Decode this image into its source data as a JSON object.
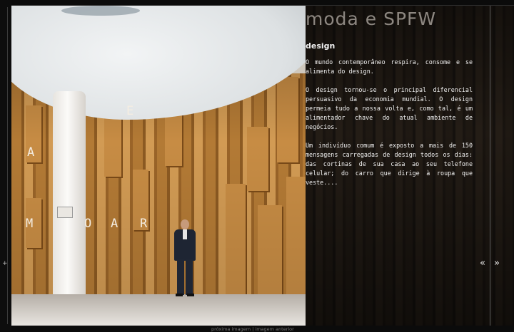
{
  "section": {
    "title": "moda e SPFW",
    "subtitle": "design",
    "paragraphs": [
      "O mundo contemporâneo respira, consome e se alimenta do design.",
      "O design tornou-se o principal diferencial persuasivo da economia mundial. O design permeia tudo a nossa volta e, como tal, é um alimentador chave do atual ambiente de negócios.",
      "Um indivíduo comum é exposto a mais de 150 mensagens carregadas de design todos os dias: das cortinas de sua casa ao seu telefone celular; do carro que dirige à roupa que veste...."
    ]
  },
  "navigation": {
    "prev_icon": "«",
    "next_icon": "»",
    "next_image_label": "próxima imagem",
    "separator": "|",
    "prev_image_label": "imagem anterior"
  },
  "photo": {
    "wall_letters": [
      "E",
      "A",
      "M",
      "O",
      "A",
      "R"
    ]
  },
  "colors": {
    "wall": "#b37a35",
    "panel_text": "#f2f2f2",
    "heading": "#8d8781"
  }
}
